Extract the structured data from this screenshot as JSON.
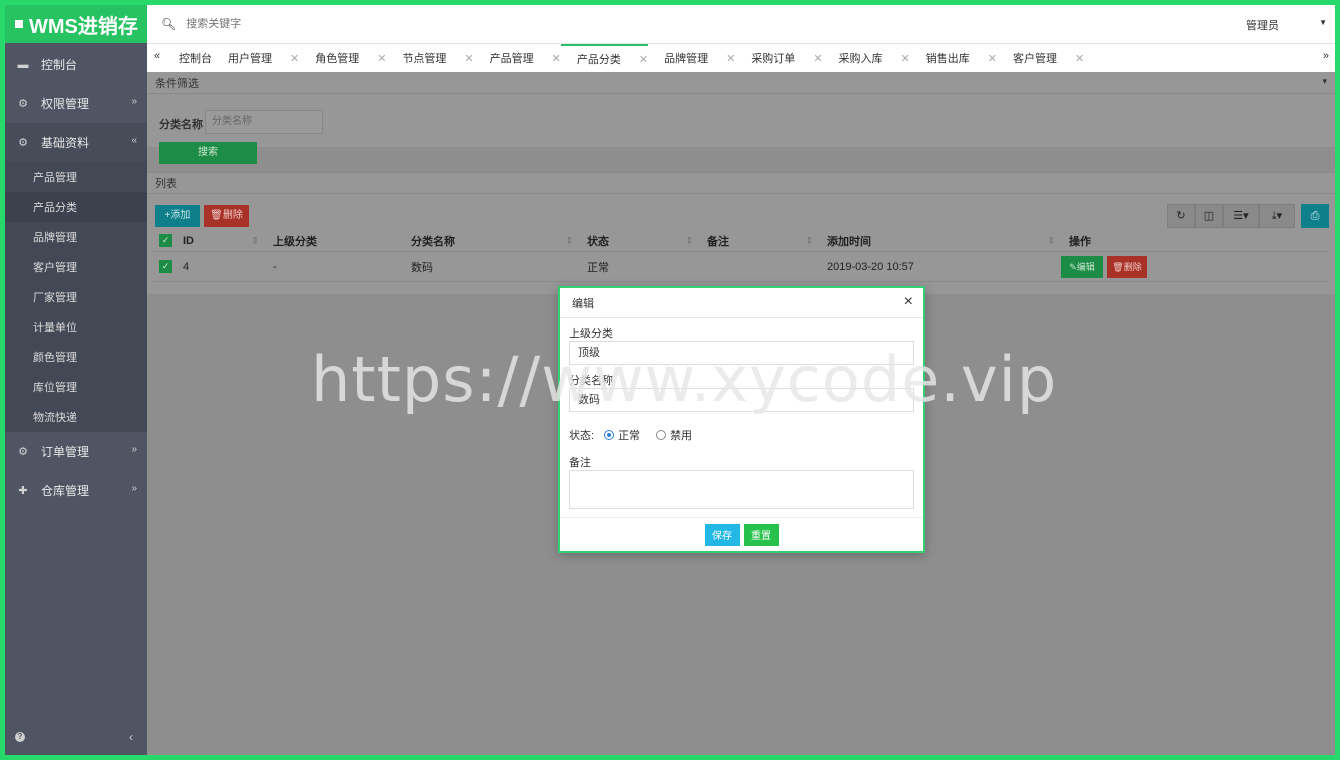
{
  "app": {
    "brand": "WMS进销存"
  },
  "header": {
    "search_placeholder": "搜索关键字",
    "user": "管理员"
  },
  "sidebar": {
    "groups": [
      {
        "label": "控制台"
      },
      {
        "label": "权限管理"
      },
      {
        "label": "基础资料"
      },
      {
        "label": "订单管理"
      },
      {
        "label": "仓库管理"
      }
    ],
    "sub_items": [
      "产品管理",
      "产品分类",
      "品牌管理",
      "客户管理",
      "厂家管理",
      "计量单位",
      "颜色管理",
      "库位管理",
      "物流快递"
    ]
  },
  "tabs": [
    "控制台",
    "用户管理",
    "角色管理",
    "节点管理",
    "产品管理",
    "产品分类",
    "品牌管理",
    "采购订单",
    "采购入库",
    "销售出库",
    "客户管理"
  ],
  "filter": {
    "title": "条件筛选",
    "label": "分类名称",
    "placeholder": "分类名称",
    "search_button": "搜索"
  },
  "list": {
    "title": "列表",
    "add_button": "+添加",
    "delete_button": "删除",
    "columns": [
      "ID",
      "上级分类",
      "分类名称",
      "状态",
      "备注",
      "添加时间",
      "操作"
    ],
    "rows": [
      {
        "id": "4",
        "parent": "-",
        "name": "数码",
        "status": "正常",
        "remark": "",
        "time": "2019-03-20 10:57",
        "edit": "编辑",
        "del": "删除"
      }
    ]
  },
  "modal": {
    "title": "编辑",
    "parent_label": "上级分类",
    "parent_value": "顶级",
    "name_label": "分类名称",
    "name_value": "数码",
    "status_label": "状态:",
    "status_on": "正常",
    "status_off": "禁用",
    "remark_label": "备注",
    "save": "保存",
    "reset": "重置"
  },
  "watermark": "https://www.xycode.vip"
}
